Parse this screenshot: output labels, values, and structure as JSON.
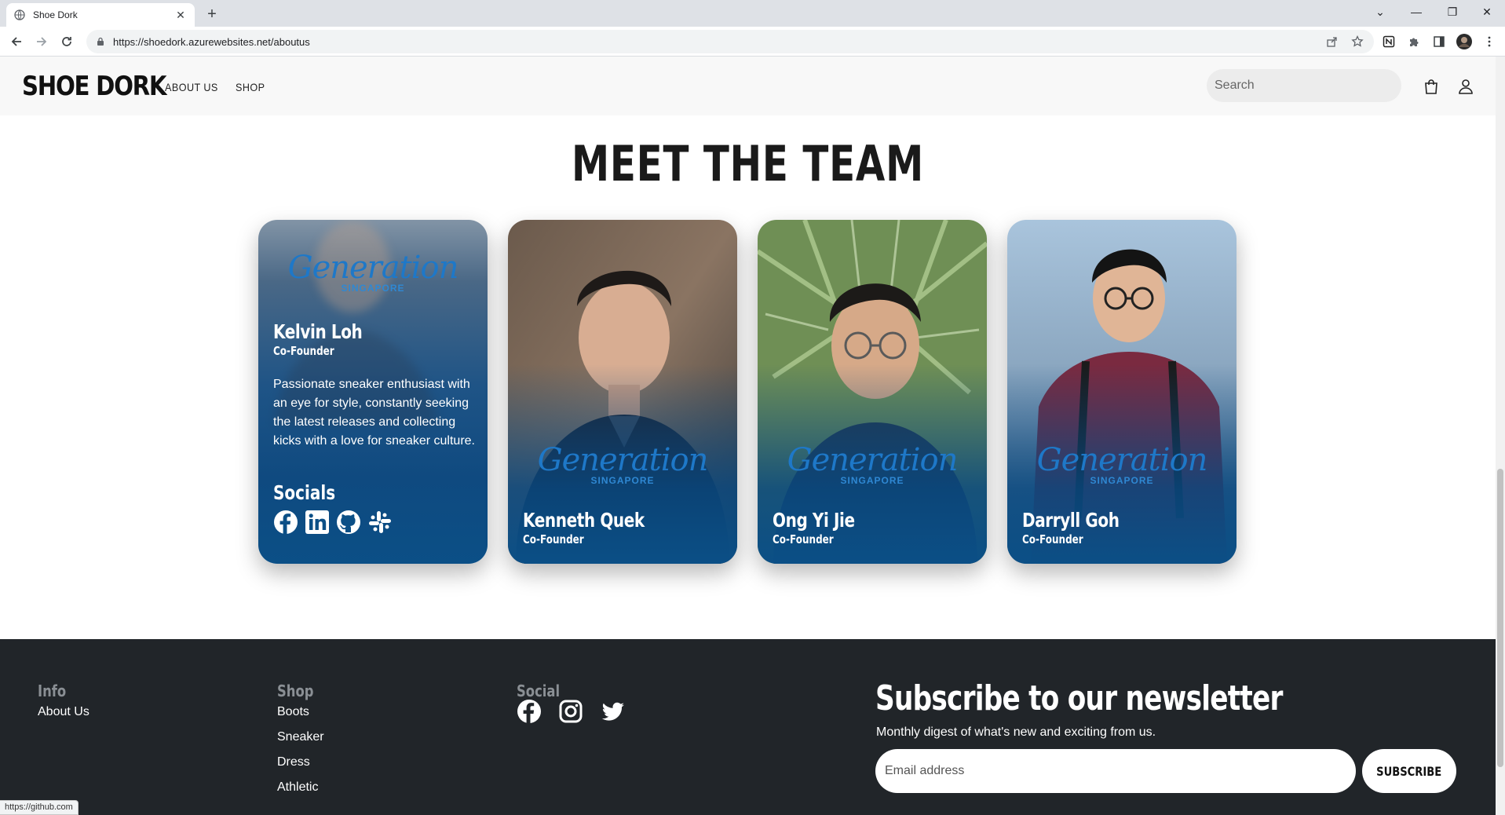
{
  "browser": {
    "tab_title": "Shoe Dork",
    "url": "https://shoedork.azurewebsites.net/aboutus",
    "status_url": "https://github.com"
  },
  "header": {
    "logo": "SHOE DORK",
    "nav": [
      "ABOUT US",
      "SHOP"
    ],
    "search_placeholder": "Search"
  },
  "team": {
    "title": "MEET THE TEAM",
    "brand_word": "Generation",
    "brand_sub": "SINGAPORE",
    "members": [
      {
        "name": "Kelvin Loh",
        "role": "Co-Founder",
        "bio": "Passionate sneaker enthusiast with an eye for style, constantly seeking the latest releases and collecting kicks with a love for sneaker culture.",
        "socials_heading": "Socials",
        "socials": [
          "facebook-icon",
          "linkedin-icon",
          "github-icon",
          "slack-icon"
        ]
      },
      {
        "name": "Kenneth Quek",
        "role": "Co-Founder"
      },
      {
        "name": "Ong Yi Jie",
        "role": "Co-Founder"
      },
      {
        "name": "Darryll Goh",
        "role": "Co-Founder"
      }
    ]
  },
  "footer": {
    "info": {
      "heading": "Info",
      "links": [
        "About Us"
      ]
    },
    "shop": {
      "heading": "Shop",
      "links": [
        "Boots",
        "Sneaker",
        "Dress",
        "Athletic"
      ]
    },
    "social": {
      "heading": "Social",
      "icons": [
        "facebook-icon",
        "instagram-icon",
        "twitter-icon"
      ]
    },
    "newsletter": {
      "title": "Subscribe to our newsletter",
      "subtitle": "Monthly digest of what's new and exciting from us.",
      "email_placeholder": "Email address",
      "button": "SUBSCRIBE"
    }
  },
  "colors": {
    "card_blue": "#0b4f86",
    "brand_blue": "#1e78c8",
    "footer_bg": "#212529"
  }
}
